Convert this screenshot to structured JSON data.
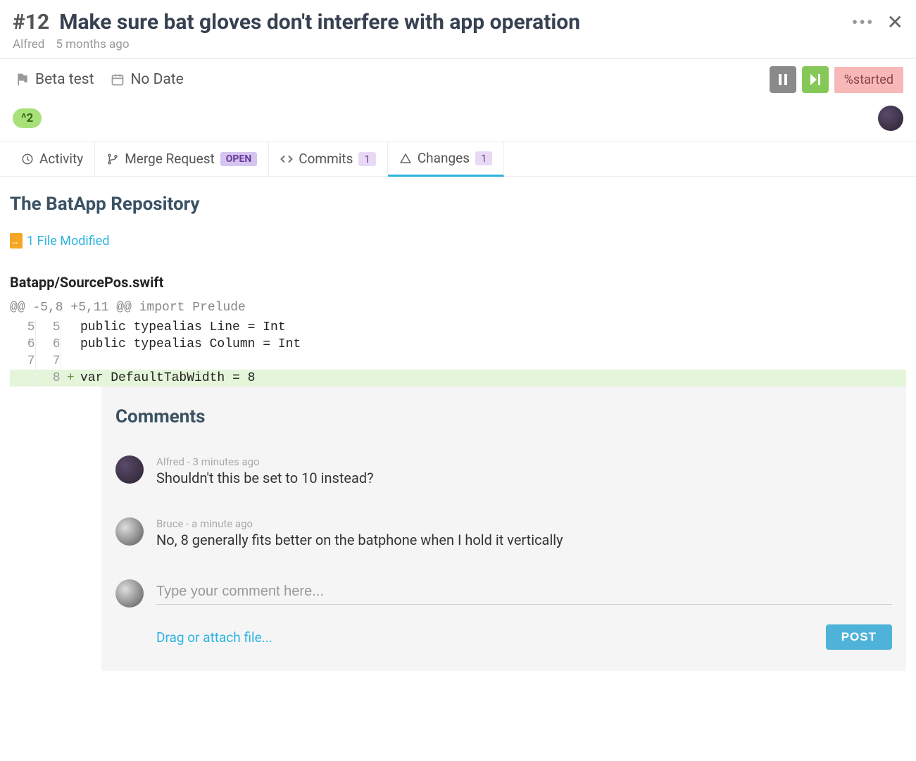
{
  "issue": {
    "number": "#12",
    "title": "Make sure bat gloves don't interfere with app operation",
    "author": "Alfred",
    "age": "5 months ago"
  },
  "toolbar": {
    "milestone": "Beta test",
    "due": "No Date",
    "status": "%started",
    "points": "^2"
  },
  "tabs": {
    "activity": "Activity",
    "merge_request": "Merge Request",
    "mr_badge": "OPEN",
    "commits": "Commits",
    "commits_count": "1",
    "changes": "Changes",
    "changes_count": "1"
  },
  "repo": {
    "title": "The BatApp Repository",
    "files_modified": "1 File Modified",
    "file_path": "Batapp/SourcePos.swift",
    "hunk": "@@ -5,8 +5,11 @@ import Prelude"
  },
  "diff": [
    {
      "old": "5",
      "new": "5",
      "sign": "",
      "code": "public typealias Line = Int",
      "added": false
    },
    {
      "old": "6",
      "new": "6",
      "sign": "",
      "code": "public typealias Column = Int",
      "added": false
    },
    {
      "old": "7",
      "new": "7",
      "sign": "",
      "code": "",
      "added": false
    },
    {
      "old": "",
      "new": "8",
      "sign": "+",
      "code": "var DefaultTabWidth = 8",
      "added": true
    }
  ],
  "comments": {
    "heading": "Comments",
    "list": [
      {
        "author": "Alfred",
        "sep": " - ",
        "time": "3 minutes ago",
        "text": "Shouldn't this be set to 10 instead?",
        "avatar": "av1"
      },
      {
        "author": "Bruce",
        "sep": " - ",
        "time": "a minute ago",
        "text": "No, 8 generally fits better on the batphone when I hold it vertically",
        "avatar": "av2"
      }
    ],
    "placeholder": "Type your comment here...",
    "attach": "Drag or attach file...",
    "post": "POST"
  }
}
